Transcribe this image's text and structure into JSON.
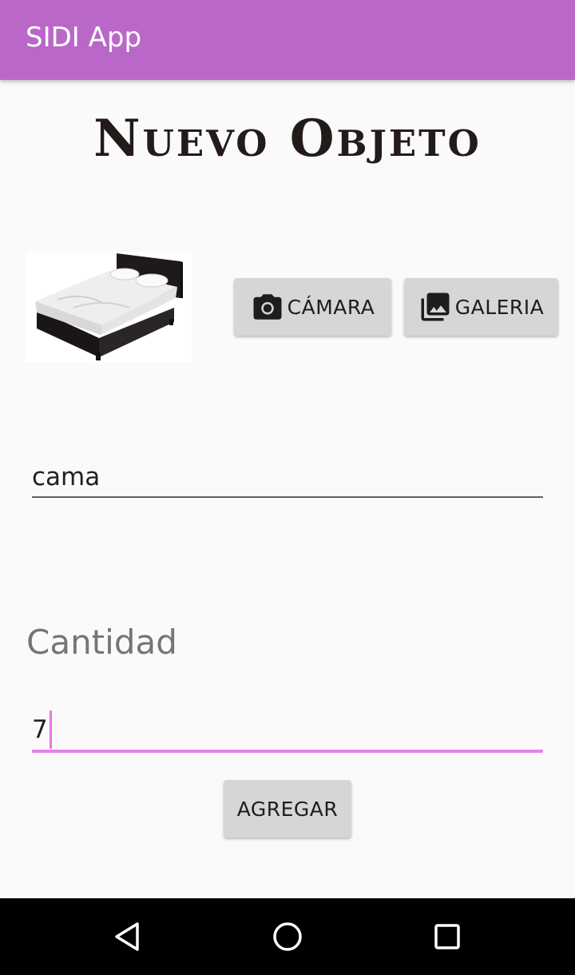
{
  "appbar": {
    "title": "SIDI App",
    "color": "#ba68c8"
  },
  "page": {
    "title": "Nuevo Objeto"
  },
  "photo": {
    "subject_icon": "bed-icon"
  },
  "buttons": {
    "camera": {
      "label": "CÁMARA",
      "icon": "camera-icon"
    },
    "gallery": {
      "label": "GALERIA",
      "icon": "photo-library-icon"
    },
    "add": {
      "label": "AGREGAR"
    }
  },
  "form": {
    "name": {
      "value": "cama"
    },
    "quantity": {
      "label": "Cantidad",
      "value": "7",
      "accent": "#e782ea"
    }
  },
  "navbar": {
    "back_icon": "back-triangle-icon",
    "home_icon": "home-circle-icon",
    "recent_icon": "recent-square-icon"
  }
}
